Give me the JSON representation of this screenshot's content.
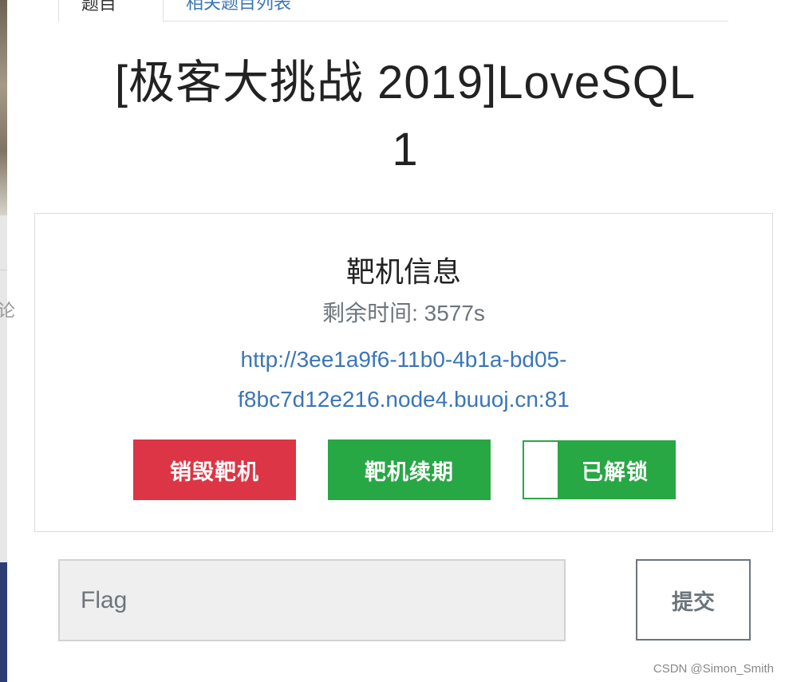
{
  "tabs": {
    "active_label": "题目",
    "other_label": "相关题目列表"
  },
  "challenge": {
    "title_line1": "[极客大挑战 2019]LoveSQL",
    "title_line2": "1"
  },
  "panel": {
    "title": "靶机信息",
    "time_label": "剩余时间:",
    "time_value": "3577s",
    "url_line1": "http://3ee1a9f6-11b0-4b1a-bd05-",
    "url_line2": "f8bc7d12e216.node4.buuoj.cn:81"
  },
  "buttons": {
    "destroy": "销毁靶机",
    "renew": "靶机续期",
    "unlock": "已解锁"
  },
  "flag": {
    "placeholder": "Flag",
    "value": "",
    "submit": "提交"
  },
  "watermark": "CSDN @Simon_Smith",
  "colors": {
    "danger": "#dc3545",
    "success": "#28a745",
    "link": "#3a76b5",
    "muted": "#6c757d"
  }
}
